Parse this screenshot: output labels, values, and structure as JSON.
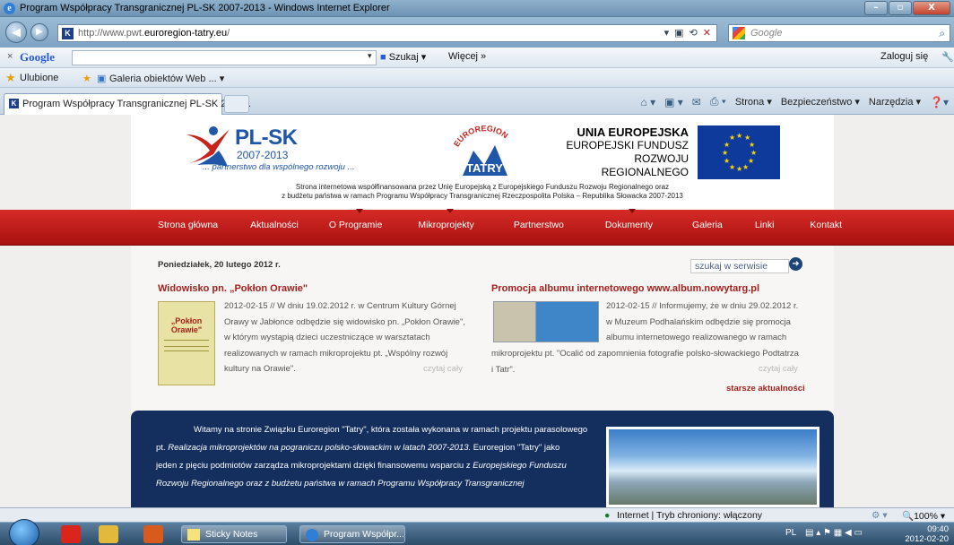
{
  "window": {
    "title": "Program Współpracy Transgranicznej PL-SK 2007-2013 - Windows Internet Explorer",
    "buttons": [
      "–",
      "▫",
      "X"
    ]
  },
  "address_bar": {
    "url_prefix": "http://www.pwt.",
    "url_domain": "euroregion-tatry.eu",
    "url_suffix": "/",
    "search_placeholder": "Google"
  },
  "google_toolbar": {
    "logo": "Google",
    "search_label": "Szukaj",
    "more_label": "Więcej »",
    "login_label": "Zaloguj się"
  },
  "favorites_bar": {
    "favorites_label": "Ulubione",
    "gallery_label": "Galeria obiektów Web ..."
  },
  "tab": {
    "title": "Program Współpracy Transgranicznej PL-SK 2007..."
  },
  "command_bar": {
    "strona": "Strona",
    "bezpieczenstwo": "Bezpieczeństwo",
    "narzedzia": "Narzędzia"
  },
  "site": {
    "logo_main": "PL-SK",
    "logo_years": "2007-2013",
    "logo_tagline": "... partnerstwo dla wspólnego rozwoju ...",
    "euroregion_word": "EUROREGION",
    "tatry_word": "TATRY",
    "eu_line1": "UNIA EUROPEJSKA",
    "eu_line2": "EUROPEJSKI FUNDUSZ",
    "eu_line3": "ROZWOJU REGIONALNEGO",
    "cofinance_line1": "Strona internetowa współfinansowana przez Unię Europejską z Europejskiego Funduszu Rozwoju Regionalnego oraz",
    "cofinance_line2": "z budżetu państwa w ramach Programu Współpracy Transgranicznej Rzeczpospolita Polska – Republika Słowacka 2007-2013",
    "menu": [
      "Strona główna",
      "Aktualności",
      "O Programie",
      "Mikroprojekty",
      "Partnerstwo",
      "Dokumenty",
      "Galeria",
      "Linki",
      "Kontakt"
    ],
    "date": "Poniedziałek, 20 lutego 2012 r.",
    "search_value": "szukaj w serwisie",
    "news": [
      {
        "title": "Widowisko pn. „Pokłon Orawie\"",
        "img_caption": "„Pokłon Orawie\"",
        "line1": "2012-02-15 // W dniu 19.02.2012 r. w Centrum Kultury Górnej",
        "line2": "Orawy w Jabłonce odbędzie się widowisko pn. „Pokłon Orawie\",",
        "line3": "w którym wystąpią dzieci uczestniczące w warsztatach",
        "line4": "realizowanych w ramach mikroprojektu pt. „Wspólny rozwój",
        "line5": "kultury na Orawie\".",
        "more": "czytaj cały"
      },
      {
        "title": "Promocja albumu internetowego www.album.nowytarg.pl",
        "line1": "2012-02-15 // Informujemy, że w dniu 29.02.2012 r.",
        "line2": "w Muzeum Podhalańskim odbędzie się promocja",
        "line3": "albumu internetowego realizowanego w ramach",
        "line4": "mikroprojektu pt. \"Ocalić od zapomnienia fotografie polsko-słowackiego Podtatrza",
        "line5": "i Tatr\".",
        "more": "czytaj cały"
      }
    ],
    "older_news": "starsze aktualności",
    "welcome": {
      "p1": "Witamy na stronie Związku Euroregion \"Tatry\", która została wykonana w ramach projektu parasolowego",
      "p2a": "pt. ",
      "p2i": "Realizacja mikroprojektów na pograniczu polsko-słowackim w latach 2007-2013.",
      "p2b": " Euroregion \"Tatry\" jako",
      "p3a": "jeden z pięciu podmiotów zarządza mikroprojektami dzięki finansowemu wsparciu z ",
      "p3i": "Europejskiego Funduszu",
      "p4i": "Rozwoju Regionalnego oraz z budżetu państwa w ramach Programu Współpracy Transgranicznej"
    }
  },
  "status_bar": {
    "zone": "Internet | Tryb chroniony: włączony",
    "zoom": "100%"
  },
  "taskbar": {
    "sticky_notes": "Sticky Notes",
    "ie_task": "Program Współpr...",
    "lang": "PL",
    "time": "09:40",
    "date": "2012-02-20"
  }
}
